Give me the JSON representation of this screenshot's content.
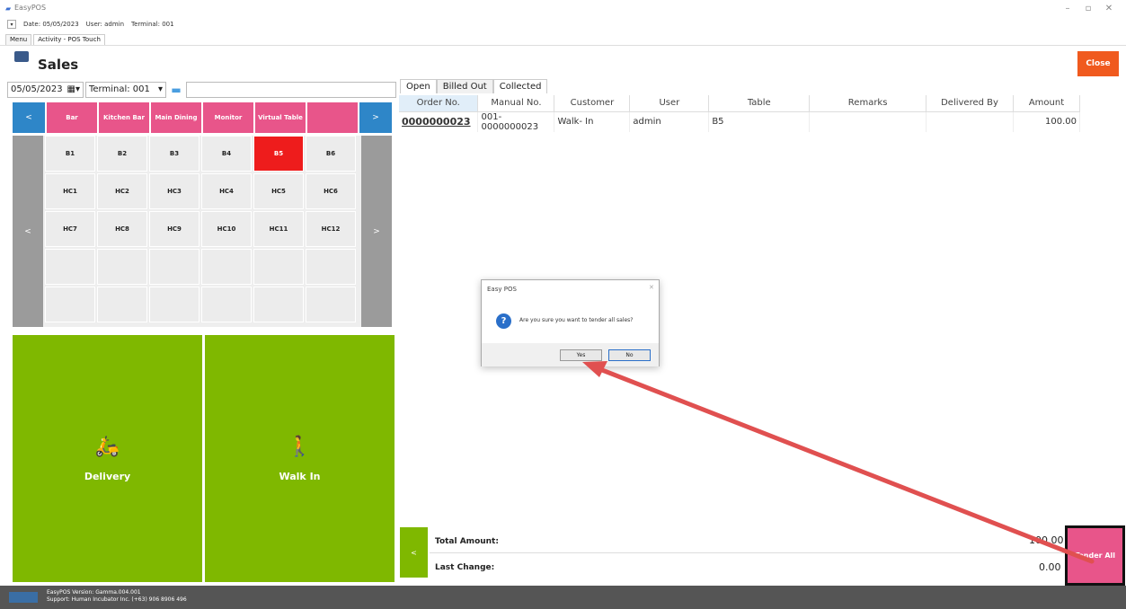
{
  "window": {
    "app_title": "EasyPOS",
    "sysinfo": {
      "date": "Date: 05/05/2023",
      "user": "User: admin",
      "terminal": "Terminal: 001"
    },
    "controls": [
      "–",
      "▫",
      "✕"
    ]
  },
  "tabs": [
    "Menu",
    "Activity - POS Touch"
  ],
  "header": {
    "title": "Sales",
    "close_label": "Close"
  },
  "filter": {
    "date": "05/05/2023",
    "terminal": "Terminal: 001",
    "search_placeholder": ""
  },
  "table_groups": {
    "prev": "<",
    "next": ">",
    "groups": [
      "Bar",
      "Kitchen Bar",
      "Main Dining",
      "Monitor",
      "Virtual Table",
      ""
    ]
  },
  "tables": {
    "prev": "<",
    "next": ">",
    "cells": [
      "B1",
      "B2",
      "B3",
      "B4",
      "B5",
      "B6",
      "HC1",
      "HC2",
      "HC3",
      "HC4",
      "HC5",
      "HC6",
      "HC7",
      "HC8",
      "HC9",
      "HC10",
      "HC11",
      "HC12",
      "",
      "",
      "",
      "",
      "",
      "",
      "",
      "",
      "",
      "",
      "",
      ""
    ],
    "selected": "B5"
  },
  "actions": {
    "delivery": "Delivery",
    "walkin": "Walk In"
  },
  "sales_tabs": [
    "Open",
    "Billed Out",
    "Collected"
  ],
  "sales_table": {
    "columns": [
      "Order No.",
      "Manual No.",
      "Customer",
      "User",
      "Table",
      "Remarks",
      "Delivered By",
      "Amount"
    ],
    "rows": [
      [
        "0000000023",
        "001-0000000023",
        "Walk- In",
        "admin",
        "B5",
        "",
        "",
        "100.00"
      ]
    ]
  },
  "totals": {
    "side_nav": "<",
    "total_amount_label": "Total Amount:",
    "total_amount": "100.00",
    "last_change_label": "Last Change:",
    "last_change": "0.00",
    "tender_label": "Tender All"
  },
  "dialog": {
    "title": "Easy POS",
    "message": "Are you sure you want to tender all sales?",
    "yes": "Yes",
    "no": "No"
  },
  "status": {
    "version": "EasyPOS Version: Gamma.004.001",
    "support": "Support: Human Incubator Inc. (+63) 906 8906 496"
  },
  "colors": {
    "accent_pink": "#e8558a",
    "nav_blue": "#2e86c8",
    "selected_red": "#ee1c1c",
    "green": "#7fb800",
    "close_orange": "#f05a1e",
    "arrow": "#e05050"
  }
}
